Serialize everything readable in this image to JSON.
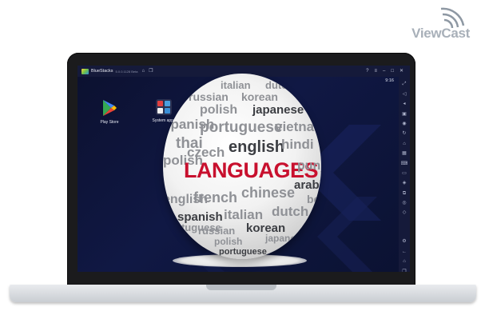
{
  "watermark": {
    "text": "ViewCast"
  },
  "app": {
    "name": "BlueStacks",
    "version": "5.0.0.1128 Beta",
    "time": "9:16",
    "desktop_icons": [
      {
        "label": "Play Store",
        "icon": "play-store-icon"
      },
      {
        "label": "System apps",
        "icon": "system-apps-icon"
      }
    ],
    "titlebar_icons": [
      "home-icon",
      "multi-instance-icon"
    ],
    "window_controls": [
      "help-icon",
      "menu-icon",
      "minimize-icon",
      "restore-icon",
      "close-icon"
    ],
    "sidebar_icons": [
      "fullscreen-icon",
      "volume-up-icon",
      "volume-down-icon",
      "media-icon",
      "screenshot-icon",
      "rotate-icon",
      "shake-icon",
      "macro-icon",
      "keyboard-icon",
      "folder-icon",
      "location-icon",
      "copy-icon",
      "eco-icon",
      "layers-icon",
      "settings-icon",
      "back-icon",
      "home-icon",
      "recents-icon"
    ]
  },
  "globe": {
    "words": [
      "italian",
      "dutch",
      "russian",
      "korean",
      "japanese",
      "polish",
      "spanish",
      "portuguese",
      "vietnamese",
      "thai",
      "czech",
      "english",
      "hindi",
      "polish",
      "LANGUAGES",
      "punjabi",
      "english",
      "french",
      "chinese",
      "arabic",
      "spanish",
      "italian",
      "dutch",
      "bengali",
      "portuguese",
      "korean",
      "russian",
      "polish",
      "japanese",
      "portuguese"
    ]
  },
  "colors": {
    "accent": "#c8102e",
    "screen_bg": "#0d1230",
    "titlebar": "#151a3a"
  }
}
